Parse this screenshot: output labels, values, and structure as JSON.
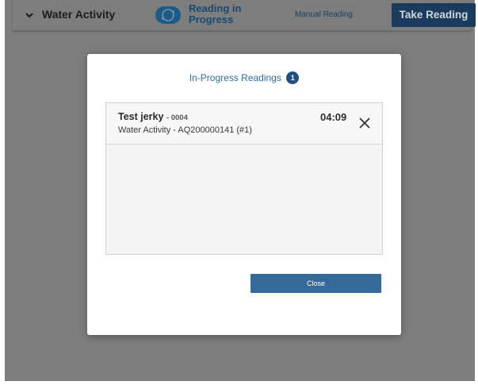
{
  "header": {
    "title": "Water Activity",
    "status_line1": "Reading in",
    "status_line2": "Progress",
    "manual_label": "Manual Reading",
    "take_reading_label": "Take Reading"
  },
  "modal": {
    "title": "In-Progress Readings",
    "count": "1",
    "items": [
      {
        "name": "Test jerky",
        "id": "- 0004",
        "subtitle": "Water Activity - AQ200000141 (#1)",
        "time": "04:09"
      }
    ],
    "close_label": "Close"
  }
}
